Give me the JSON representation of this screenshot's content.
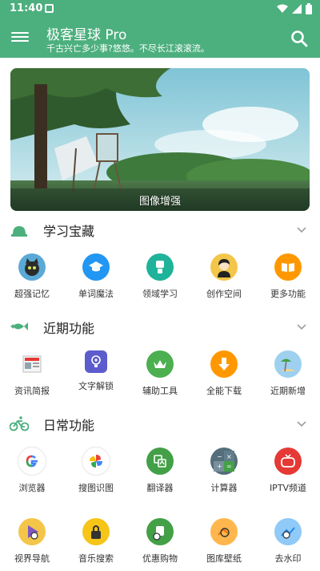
{
  "status_bar": {
    "time": "11:40"
  },
  "app_bar": {
    "title": "极客星球 Pro",
    "subtitle": "千古兴亡多少事?悠悠。不尽长江滚滚流。"
  },
  "banner": {
    "caption": "图像增强"
  },
  "sections": [
    {
      "title": "学习宝藏",
      "items": [
        {
          "label": "超强记忆",
          "icon": "cat-icon",
          "color": "#5aa9d6"
        },
        {
          "label": "单词魔法",
          "icon": "graduation-cap-icon",
          "color": "#2196f3"
        },
        {
          "label": "领域学习",
          "icon": "book-icon",
          "color": "#1fb39a"
        },
        {
          "label": "创作空间",
          "icon": "avatar-icon",
          "color": "#f3c64a"
        },
        {
          "label": "更多功能",
          "icon": "open-book-icon",
          "color": "#ff9800"
        }
      ]
    },
    {
      "title": "近期功能",
      "items": [
        {
          "label": "资讯简报",
          "icon": "newspaper-icon",
          "color": "#ffffff"
        },
        {
          "label": "文字解锁",
          "icon": "lightbulb-icon",
          "color": "#5c5ccc"
        },
        {
          "label": "辅助工具",
          "icon": "crown-icon",
          "color": "#4caf50"
        },
        {
          "label": "全能下载",
          "icon": "download-icon",
          "color": "#ff9800"
        },
        {
          "label": "近期新增",
          "icon": "beach-icon",
          "color": "#9ed0ef"
        }
      ]
    },
    {
      "title": "日常功能",
      "items": [
        {
          "label": "浏览器",
          "icon": "google-icon",
          "color": "#ffffff"
        },
        {
          "label": "搜图识图",
          "icon": "pinwheel-icon",
          "color": "#ffffff"
        },
        {
          "label": "翻译器",
          "icon": "translate-icon",
          "color": "#43a047"
        },
        {
          "label": "计算器",
          "icon": "calculator-icon",
          "color": "#546e7a"
        },
        {
          "label": "IPTV频道",
          "icon": "tv-icon",
          "color": "#e53935"
        }
      ]
    },
    {
      "title": "",
      "items": [
        {
          "label": "视界导航",
          "icon": "play-icon",
          "color": "#7e57c2"
        },
        {
          "label": "音乐搜索",
          "icon": "music-icon",
          "color": "#f5c518"
        },
        {
          "label": "优惠购物",
          "icon": "shopping-icon",
          "color": "#43a047"
        },
        {
          "label": "图库壁纸",
          "icon": "gallery-icon",
          "color": "#ffb74d"
        },
        {
          "label": "去水印",
          "icon": "watermark-icon",
          "color": "#90caf9"
        }
      ]
    }
  ]
}
